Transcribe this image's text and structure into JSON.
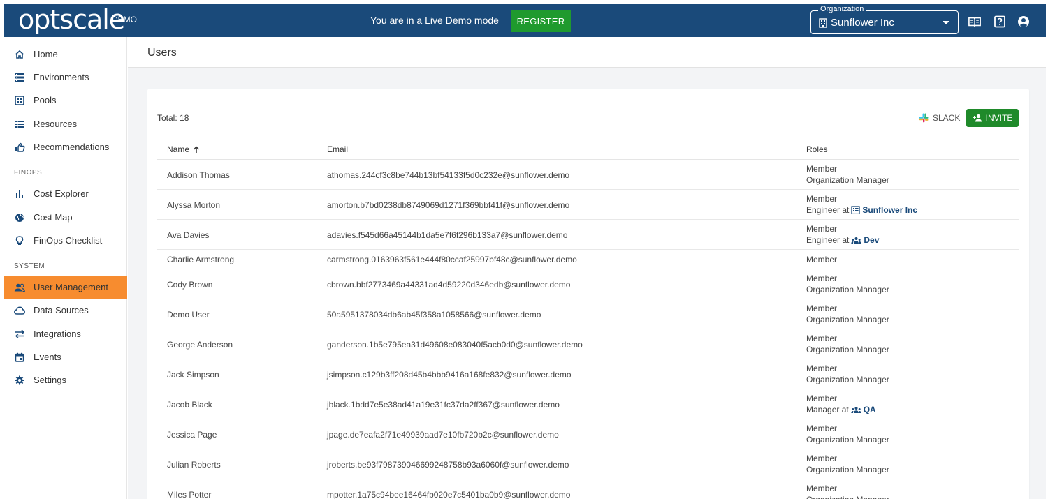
{
  "topbar": {
    "logo": "optscale",
    "logo_badge": "DEMO",
    "demo_notice": "You are in a Live Demo mode",
    "register_label": "REGISTER",
    "org_label": "Organization",
    "org_value": "Sunflower Inc"
  },
  "sidebar": {
    "items": [
      {
        "label": "Home",
        "icon": "home-icon"
      },
      {
        "label": "Environments",
        "icon": "environments-icon"
      },
      {
        "label": "Pools",
        "icon": "pools-icon"
      },
      {
        "label": "Resources",
        "icon": "resources-icon"
      },
      {
        "label": "Recommendations",
        "icon": "thumbs-up-icon"
      }
    ],
    "finops_label": "FINOPS",
    "finops_items": [
      {
        "label": "Cost Explorer",
        "icon": "bar-chart-icon"
      },
      {
        "label": "Cost Map",
        "icon": "globe-icon"
      },
      {
        "label": "FinOps Checklist",
        "icon": "lightbulb-icon"
      }
    ],
    "system_label": "SYSTEM",
    "system_items": [
      {
        "label": "User Management",
        "icon": "users-icon",
        "active": true
      },
      {
        "label": "Data Sources",
        "icon": "cloud-icon"
      },
      {
        "label": "Integrations",
        "icon": "swap-icon"
      },
      {
        "label": "Events",
        "icon": "calendar-icon"
      },
      {
        "label": "Settings",
        "icon": "gear-icon"
      }
    ]
  },
  "page": {
    "title": "Users",
    "total": "Total: 18",
    "slack_label": "SLACK",
    "invite_label": "INVITE"
  },
  "table": {
    "columns": [
      "Name",
      "Email",
      "Roles"
    ],
    "rows": [
      {
        "name": "Addison Thomas",
        "email": "athomas.244cf3c8be744b13bf54133f5d0c232e@sunflower.demo",
        "roles": [
          {
            "text": "Member"
          },
          {
            "text": "Organization Manager"
          }
        ]
      },
      {
        "name": "Alyssa Morton",
        "email": "amorton.b7bd0238db8749069d1271f369bbf41f@sunflower.demo",
        "roles": [
          {
            "text": "Member"
          },
          {
            "text": "Engineer at",
            "link": "Sunflower Inc",
            "link_icon": "building"
          }
        ]
      },
      {
        "name": "Ava Davies",
        "email": "adavies.f545d66a45144b1da5e7f6f296b133a7@sunflower.demo",
        "roles": [
          {
            "text": "Member"
          },
          {
            "text": "Engineer at",
            "link": "Dev",
            "link_icon": "group"
          }
        ]
      },
      {
        "name": "Charlie Armstrong",
        "email": "carmstrong.0163963f561e444f80ccaf25997bf48c@sunflower.demo",
        "roles": [
          {
            "text": "Member"
          }
        ]
      },
      {
        "name": "Cody Brown",
        "email": "cbrown.bbf2773469a44331ad4d59220d346edb@sunflower.demo",
        "roles": [
          {
            "text": "Member"
          },
          {
            "text": "Organization Manager"
          }
        ]
      },
      {
        "name": "Demo User",
        "email": "50a5951378034db6ab45f358a1058566@sunflower.demo",
        "roles": [
          {
            "text": "Member"
          },
          {
            "text": "Organization Manager"
          }
        ]
      },
      {
        "name": "George Anderson",
        "email": "ganderson.1b5e795ea31d49608e083040f5acb0d0@sunflower.demo",
        "roles": [
          {
            "text": "Member"
          },
          {
            "text": "Organization Manager"
          }
        ]
      },
      {
        "name": "Jack Simpson",
        "email": "jsimpson.c129b3ff208d45b4bbb9416a168fe832@sunflower.demo",
        "roles": [
          {
            "text": "Member"
          },
          {
            "text": "Organization Manager"
          }
        ]
      },
      {
        "name": "Jacob Black",
        "email": "jblack.1bdd7e5e38ad41a19e31fc37da2ff367@sunflower.demo",
        "roles": [
          {
            "text": "Member"
          },
          {
            "text": "Manager at",
            "link": "QA",
            "link_icon": "group"
          }
        ]
      },
      {
        "name": "Jessica Page",
        "email": "jpage.de7eafa2f71e49939aad7e10fb720b2c@sunflower.demo",
        "roles": [
          {
            "text": "Member"
          },
          {
            "text": "Organization Manager"
          }
        ]
      },
      {
        "name": "Julian Roberts",
        "email": "jroberts.be93f798739046699248758b93a6060f@sunflower.demo",
        "roles": [
          {
            "text": "Member"
          },
          {
            "text": "Organization Manager"
          }
        ]
      },
      {
        "name": "Miles Potter",
        "email": "mpotter.1a75c94bee16464fb020e7c5401ba0b9@sunflower.demo",
        "roles": [
          {
            "text": "Member"
          },
          {
            "text": "Organization Manager"
          }
        ]
      }
    ]
  }
}
